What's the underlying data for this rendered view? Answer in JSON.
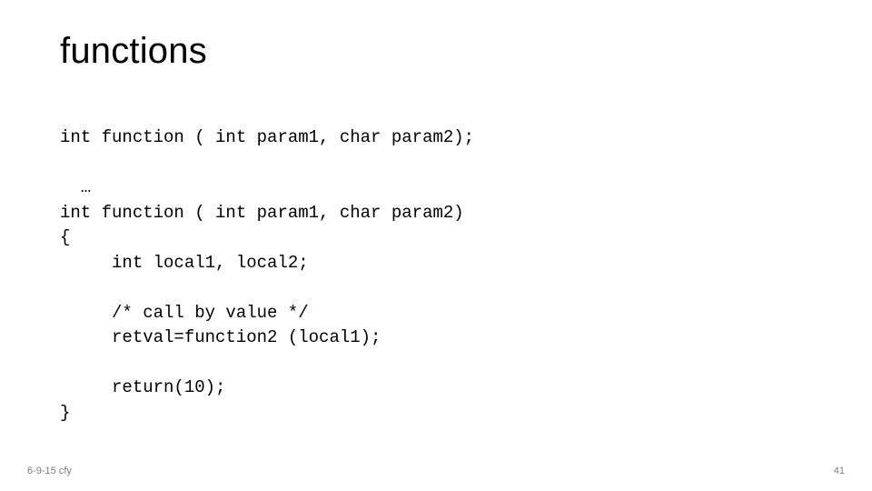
{
  "slide": {
    "title": "functions",
    "code": "int function ( int param1, char param2);\n\n  …\nint function ( int param1, char param2)\n{\n     int local1, local2;\n\n     /* call by value */\n     retval=function2 (local1);\n\n     return(10);\n}",
    "footer_left": "6-9-15 cfy",
    "footer_right": "41"
  }
}
